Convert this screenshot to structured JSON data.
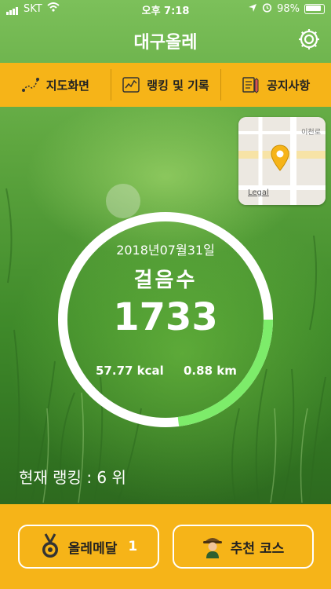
{
  "status": {
    "carrier": "SKT",
    "time": "오후 7:18",
    "battery": "98%"
  },
  "header": {
    "title": "대구올레"
  },
  "menu": [
    {
      "label": "지도화면",
      "icon": "route-icon"
    },
    {
      "label": "랭킹 및 기록",
      "icon": "chart-icon"
    },
    {
      "label": "공지사항",
      "icon": "notice-icon"
    }
  ],
  "map": {
    "road_label": "이천로",
    "legal": "Legal"
  },
  "steps": {
    "date": "2018년07월31일",
    "label": "걸음수",
    "value": "1733",
    "kcal": "57.77 kcal",
    "km": "0.88 km",
    "progress": 0.23
  },
  "ranking": "현재 랭킹 : 6 위",
  "buttons": {
    "medal_label": "올레메달",
    "medal_count": "1",
    "course_label": "추천 코스"
  },
  "colors": {
    "accent": "#f6b418",
    "ring_progress": "#7dec6a",
    "ring_track": "#ffffff"
  }
}
